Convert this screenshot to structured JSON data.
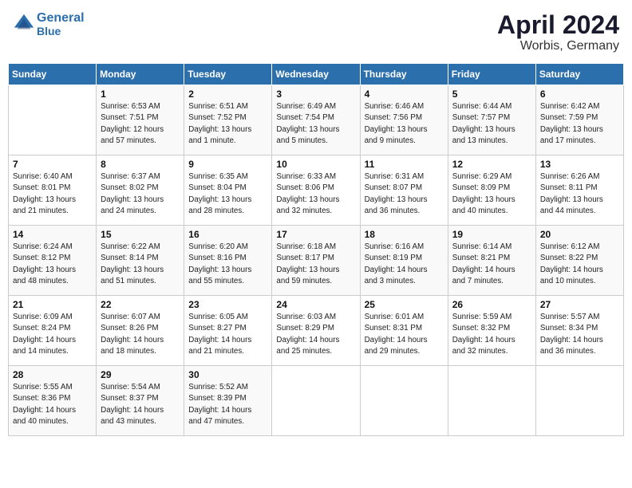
{
  "header": {
    "logo_line1": "General",
    "logo_line2": "Blue",
    "month": "April 2024",
    "location": "Worbis, Germany"
  },
  "weekdays": [
    "Sunday",
    "Monday",
    "Tuesday",
    "Wednesday",
    "Thursday",
    "Friday",
    "Saturday"
  ],
  "weeks": [
    [
      {
        "date": "",
        "info": ""
      },
      {
        "date": "1",
        "info": "Sunrise: 6:53 AM\nSunset: 7:51 PM\nDaylight: 12 hours\nand 57 minutes."
      },
      {
        "date": "2",
        "info": "Sunrise: 6:51 AM\nSunset: 7:52 PM\nDaylight: 13 hours\nand 1 minute."
      },
      {
        "date": "3",
        "info": "Sunrise: 6:49 AM\nSunset: 7:54 PM\nDaylight: 13 hours\nand 5 minutes."
      },
      {
        "date": "4",
        "info": "Sunrise: 6:46 AM\nSunset: 7:56 PM\nDaylight: 13 hours\nand 9 minutes."
      },
      {
        "date": "5",
        "info": "Sunrise: 6:44 AM\nSunset: 7:57 PM\nDaylight: 13 hours\nand 13 minutes."
      },
      {
        "date": "6",
        "info": "Sunrise: 6:42 AM\nSunset: 7:59 PM\nDaylight: 13 hours\nand 17 minutes."
      }
    ],
    [
      {
        "date": "7",
        "info": "Sunrise: 6:40 AM\nSunset: 8:01 PM\nDaylight: 13 hours\nand 21 minutes."
      },
      {
        "date": "8",
        "info": "Sunrise: 6:37 AM\nSunset: 8:02 PM\nDaylight: 13 hours\nand 24 minutes."
      },
      {
        "date": "9",
        "info": "Sunrise: 6:35 AM\nSunset: 8:04 PM\nDaylight: 13 hours\nand 28 minutes."
      },
      {
        "date": "10",
        "info": "Sunrise: 6:33 AM\nSunset: 8:06 PM\nDaylight: 13 hours\nand 32 minutes."
      },
      {
        "date": "11",
        "info": "Sunrise: 6:31 AM\nSunset: 8:07 PM\nDaylight: 13 hours\nand 36 minutes."
      },
      {
        "date": "12",
        "info": "Sunrise: 6:29 AM\nSunset: 8:09 PM\nDaylight: 13 hours\nand 40 minutes."
      },
      {
        "date": "13",
        "info": "Sunrise: 6:26 AM\nSunset: 8:11 PM\nDaylight: 13 hours\nand 44 minutes."
      }
    ],
    [
      {
        "date": "14",
        "info": "Sunrise: 6:24 AM\nSunset: 8:12 PM\nDaylight: 13 hours\nand 48 minutes."
      },
      {
        "date": "15",
        "info": "Sunrise: 6:22 AM\nSunset: 8:14 PM\nDaylight: 13 hours\nand 51 minutes."
      },
      {
        "date": "16",
        "info": "Sunrise: 6:20 AM\nSunset: 8:16 PM\nDaylight: 13 hours\nand 55 minutes."
      },
      {
        "date": "17",
        "info": "Sunrise: 6:18 AM\nSunset: 8:17 PM\nDaylight: 13 hours\nand 59 minutes."
      },
      {
        "date": "18",
        "info": "Sunrise: 6:16 AM\nSunset: 8:19 PM\nDaylight: 14 hours\nand 3 minutes."
      },
      {
        "date": "19",
        "info": "Sunrise: 6:14 AM\nSunset: 8:21 PM\nDaylight: 14 hours\nand 7 minutes."
      },
      {
        "date": "20",
        "info": "Sunrise: 6:12 AM\nSunset: 8:22 PM\nDaylight: 14 hours\nand 10 minutes."
      }
    ],
    [
      {
        "date": "21",
        "info": "Sunrise: 6:09 AM\nSunset: 8:24 PM\nDaylight: 14 hours\nand 14 minutes."
      },
      {
        "date": "22",
        "info": "Sunrise: 6:07 AM\nSunset: 8:26 PM\nDaylight: 14 hours\nand 18 minutes."
      },
      {
        "date": "23",
        "info": "Sunrise: 6:05 AM\nSunset: 8:27 PM\nDaylight: 14 hours\nand 21 minutes."
      },
      {
        "date": "24",
        "info": "Sunrise: 6:03 AM\nSunset: 8:29 PM\nDaylight: 14 hours\nand 25 minutes."
      },
      {
        "date": "25",
        "info": "Sunrise: 6:01 AM\nSunset: 8:31 PM\nDaylight: 14 hours\nand 29 minutes."
      },
      {
        "date": "26",
        "info": "Sunrise: 5:59 AM\nSunset: 8:32 PM\nDaylight: 14 hours\nand 32 minutes."
      },
      {
        "date": "27",
        "info": "Sunrise: 5:57 AM\nSunset: 8:34 PM\nDaylight: 14 hours\nand 36 minutes."
      }
    ],
    [
      {
        "date": "28",
        "info": "Sunrise: 5:55 AM\nSunset: 8:36 PM\nDaylight: 14 hours\nand 40 minutes."
      },
      {
        "date": "29",
        "info": "Sunrise: 5:54 AM\nSunset: 8:37 PM\nDaylight: 14 hours\nand 43 minutes."
      },
      {
        "date": "30",
        "info": "Sunrise: 5:52 AM\nSunset: 8:39 PM\nDaylight: 14 hours\nand 47 minutes."
      },
      {
        "date": "",
        "info": ""
      },
      {
        "date": "",
        "info": ""
      },
      {
        "date": "",
        "info": ""
      },
      {
        "date": "",
        "info": ""
      }
    ]
  ]
}
